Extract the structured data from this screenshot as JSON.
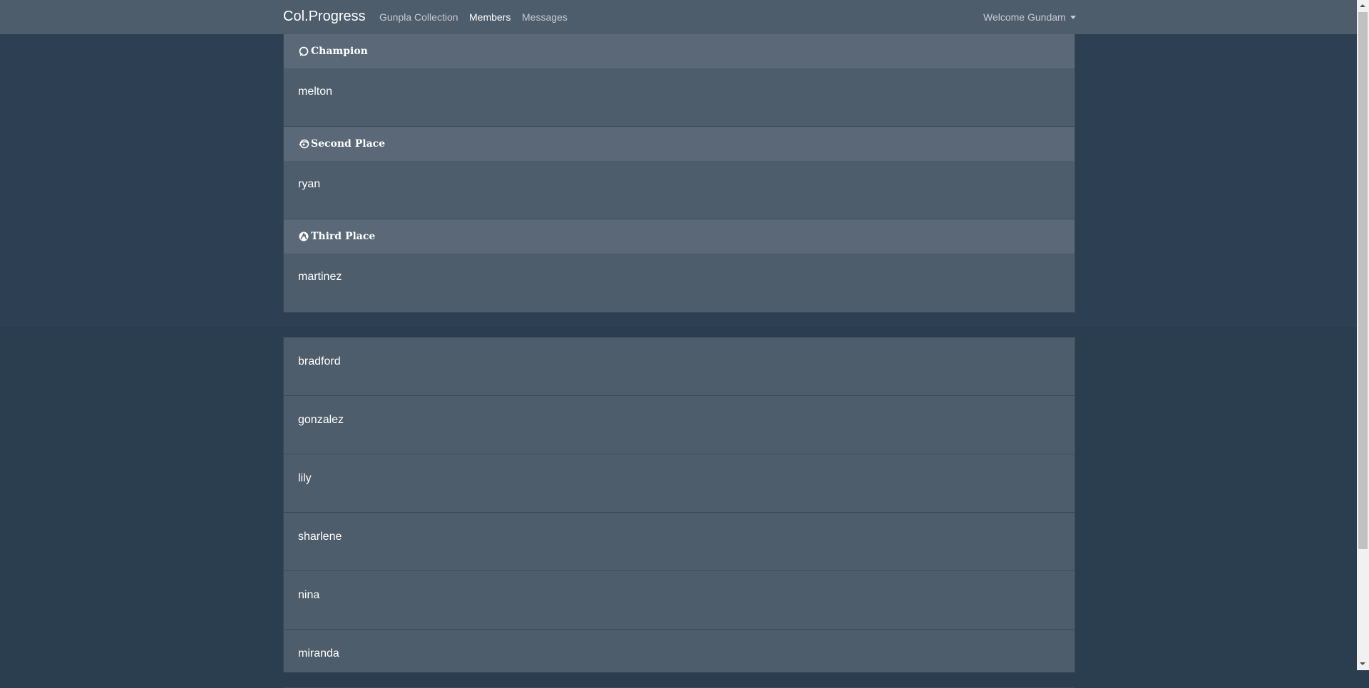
{
  "navbar": {
    "brand": "Col.Progress",
    "links": [
      {
        "label": "Gunpla Collection",
        "active": false
      },
      {
        "label": "Members",
        "active": true
      },
      {
        "label": "Messages",
        "active": false
      }
    ],
    "user_menu": "Welcome Gundam"
  },
  "ranks": [
    {
      "title": "Champion",
      "icon": "ring-icon",
      "member": "melton"
    },
    {
      "title": "Second Place",
      "icon": "orbit-icon",
      "member": "ryan"
    },
    {
      "title": "Third Place",
      "icon": "emblem-icon",
      "member": "martinez"
    }
  ],
  "members": [
    "bradford",
    "gonzalez",
    "lily",
    "sharlene",
    "nina",
    "miranda"
  ],
  "colors": {
    "background": "#2b3e50",
    "navbar": "#4e5d6c",
    "card": "#4e5d6c",
    "rank_header": "#5a6877",
    "text": "#ffffff"
  }
}
